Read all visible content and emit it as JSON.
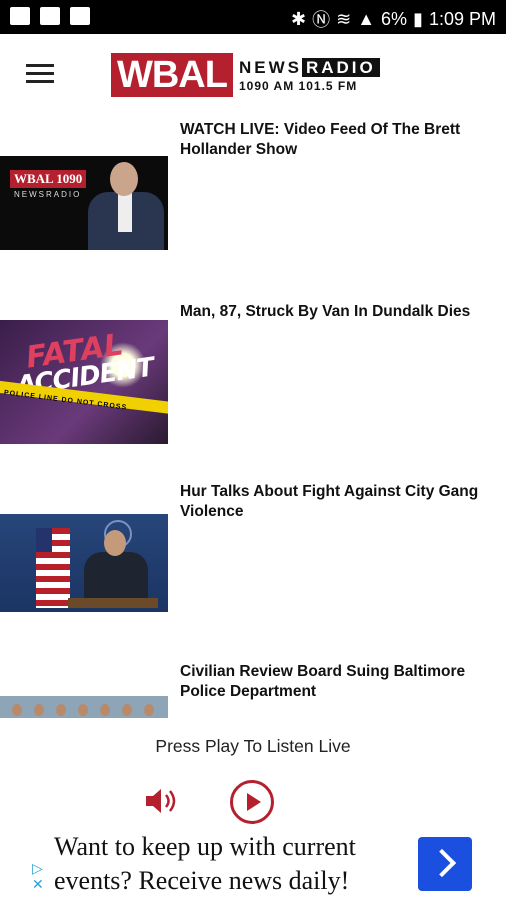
{
  "status_bar": {
    "battery": "6%",
    "time": "1:09 PM"
  },
  "header": {
    "logo_main": "WBAL",
    "logo_news": "NEWS",
    "logo_radio": "RADIO",
    "logo_freq": "1090 AM  101.5 FM"
  },
  "articles": [
    {
      "title": "WATCH LIVE: Video Feed Of The Brett Hollander Show",
      "thumb_text": "WBAL 1090",
      "thumb_sub": "NEWSRADIO"
    },
    {
      "title": "Man, 87, Struck By Van In Dundalk Dies",
      "thumb_word1": "FATAL",
      "thumb_word2": "ACCIDENT",
      "thumb_tape": "POLICE LINE DO NOT CROSS"
    },
    {
      "title": "Hur Talks About Fight Against City Gang Violence"
    },
    {
      "title": "Civilian Review Board Suing Baltimore Police Department"
    }
  ],
  "player": {
    "label": "Press Play To Listen Live"
  },
  "ad": {
    "text": "Want to keep up with current events? Receive news daily!"
  }
}
